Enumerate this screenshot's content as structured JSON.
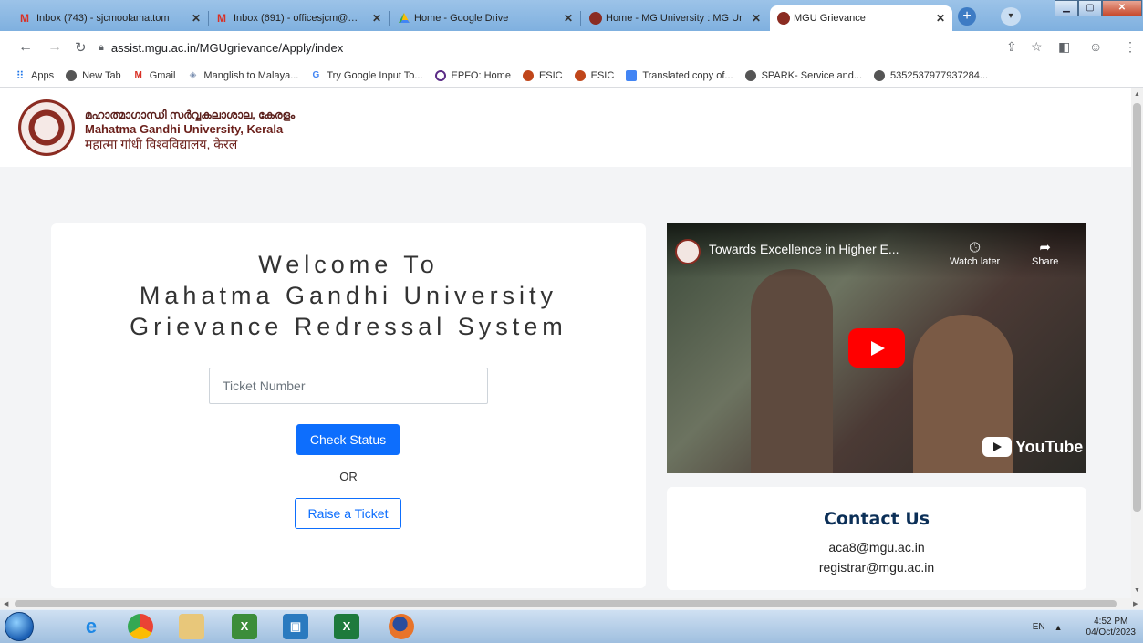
{
  "browser": {
    "tabs": [
      {
        "label": "Inbox (743) - sjcmoolamattom",
        "icon": "gmail-icon"
      },
      {
        "label": "Inbox (691) - officesjcm@gma",
        "icon": "gmail-icon"
      },
      {
        "label": "Home - Google Drive",
        "icon": "google-drive-icon"
      },
      {
        "label": "Home - MG University : MG Ur",
        "icon": "mgu-icon"
      },
      {
        "label": "MGU Grievance",
        "icon": "mgu-icon"
      }
    ],
    "close_glyph": "✕",
    "new_tab_glyph": "+",
    "url": "assist.mgu.ac.in/MGUgrievance/Apply/index",
    "bookmarks": [
      {
        "label": "Apps",
        "icon": "apps-grid-icon"
      },
      {
        "label": "New Tab",
        "icon": "globe-icon"
      },
      {
        "label": "Gmail",
        "icon": "gmail-icon"
      },
      {
        "label": "Manglish to Malaya...",
        "icon": "diamond-icon"
      },
      {
        "label": "Try Google Input To...",
        "icon": "google-icon"
      },
      {
        "label": "EPFO: Home",
        "icon": "epfo-icon"
      },
      {
        "label": "ESIC",
        "icon": "esic-icon"
      },
      {
        "label": "ESIC",
        "icon": "esic-icon"
      },
      {
        "label": "Translated copy of...",
        "icon": "doc-icon"
      },
      {
        "label": "SPARK- Service and...",
        "icon": "globe-icon"
      },
      {
        "label": "5352537977937284...",
        "icon": "globe-icon"
      }
    ]
  },
  "header": {
    "name_ml": "മഹാത്മാഗാന്ധി സർവ്വകലാശാല, കേരളം",
    "name_en": "Mahatma Gandhi University, Kerala",
    "name_hi": "महात्मा गांधी विश्वविद्यालय, केरल"
  },
  "welcome": {
    "line1": "Welcome To",
    "line2": "Mahatma Gandhi University",
    "line3": "Grievance Redressal System",
    "ticket_placeholder": "Ticket Number",
    "check_status": "Check Status",
    "or": "OR",
    "raise_ticket": "Raise a Ticket"
  },
  "video": {
    "title": "Towards Excellence in Higher E...",
    "watch_later": "Watch later",
    "share": "Share",
    "brand": "YouTube"
  },
  "contact": {
    "title": "Contact Us",
    "emails": [
      "aca8@mgu.ac.in",
      "registrar@mgu.ac.in"
    ]
  },
  "taskbar": {
    "lang": "EN",
    "time": "4:52 PM",
    "date": "04/Oct/2023"
  },
  "colors": {
    "accent": "#0d6efd",
    "header_maroon": "#6b1f1a",
    "contact_navy": "#0b2f57",
    "youtube_red": "#ff0000"
  }
}
